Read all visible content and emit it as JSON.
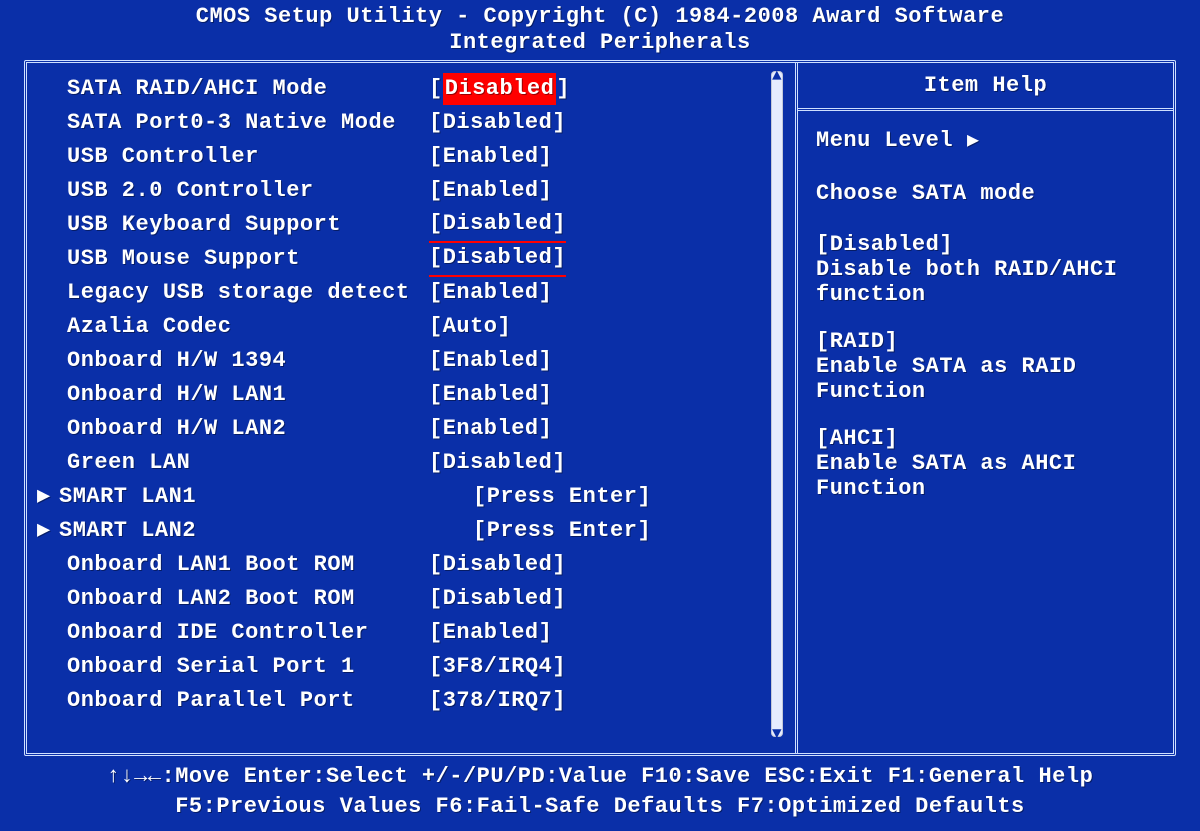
{
  "header": {
    "line1": "CMOS Setup Utility - Copyright (C) 1984-2008 Award Software",
    "line2": "Integrated Peripherals"
  },
  "settings": [
    {
      "label": "SATA RAID/AHCI Mode",
      "value": "Disabled",
      "indent": true,
      "submenu": false,
      "highlight": true,
      "underline": false
    },
    {
      "label": "SATA Port0-3 Native Mode",
      "value": "Disabled",
      "indent": true,
      "submenu": false,
      "highlight": false,
      "underline": false
    },
    {
      "label": "USB Controller",
      "value": "Enabled",
      "indent": true,
      "submenu": false,
      "highlight": false,
      "underline": false
    },
    {
      "label": "USB 2.0 Controller",
      "value": "Enabled",
      "indent": true,
      "submenu": false,
      "highlight": false,
      "underline": false
    },
    {
      "label": "USB Keyboard Support",
      "value": "Disabled",
      "indent": true,
      "submenu": false,
      "highlight": false,
      "underline": true
    },
    {
      "label": "USB Mouse Support",
      "value": "Disabled",
      "indent": true,
      "submenu": false,
      "highlight": false,
      "underline": true
    },
    {
      "label": "Legacy USB storage detect",
      "value": "Enabled",
      "indent": true,
      "submenu": false,
      "highlight": false,
      "underline": false
    },
    {
      "label": "Azalia Codec",
      "value": "Auto",
      "indent": true,
      "submenu": false,
      "highlight": false,
      "underline": false
    },
    {
      "label": "Onboard H/W 1394",
      "value": "Enabled",
      "indent": true,
      "submenu": false,
      "highlight": false,
      "underline": false
    },
    {
      "label": "Onboard H/W LAN1",
      "value": "Enabled",
      "indent": true,
      "submenu": false,
      "highlight": false,
      "underline": false
    },
    {
      "label": "Onboard H/W LAN2",
      "value": "Enabled",
      "indent": true,
      "submenu": false,
      "highlight": false,
      "underline": false
    },
    {
      "label": "Green LAN",
      "value": "Disabled",
      "indent": true,
      "submenu": false,
      "highlight": false,
      "underline": false
    },
    {
      "label": "SMART LAN1",
      "value": "Press Enter",
      "indent": false,
      "submenu": true,
      "highlight": false,
      "underline": false
    },
    {
      "label": "SMART LAN2",
      "value": "Press Enter",
      "indent": false,
      "submenu": true,
      "highlight": false,
      "underline": false
    },
    {
      "label": "Onboard LAN1 Boot ROM",
      "value": "Disabled",
      "indent": true,
      "submenu": false,
      "highlight": false,
      "underline": false
    },
    {
      "label": "Onboard LAN2 Boot ROM",
      "value": "Disabled",
      "indent": true,
      "submenu": false,
      "highlight": false,
      "underline": false
    },
    {
      "label": "Onboard IDE Controller",
      "value": "Enabled",
      "indent": true,
      "submenu": false,
      "highlight": false,
      "underline": false
    },
    {
      "label": "Onboard Serial Port 1",
      "value": "3F8/IRQ4",
      "indent": true,
      "submenu": false,
      "highlight": false,
      "underline": false
    },
    {
      "label": "Onboard Parallel Port",
      "value": "378/IRQ7",
      "indent": true,
      "submenu": false,
      "highlight": false,
      "underline": false
    }
  ],
  "help": {
    "title": "Item Help",
    "menu_level_label": "Menu Level",
    "description": "Choose SATA mode",
    "blocks": [
      {
        "head": "[Disabled]",
        "body": "Disable both RAID/AHCI function"
      },
      {
        "head": "[RAID]",
        "body": "Enable SATA as RAID Function"
      },
      {
        "head": "[AHCI]",
        "body": "Enable SATA as AHCI Function"
      }
    ]
  },
  "footer": {
    "line1": "↑↓→←:Move   Enter:Select   +/-/PU/PD:Value   F10:Save   ESC:Exit   F1:General Help",
    "line2": "F5:Previous Values   F6:Fail-Safe Defaults   F7:Optimized Defaults"
  }
}
